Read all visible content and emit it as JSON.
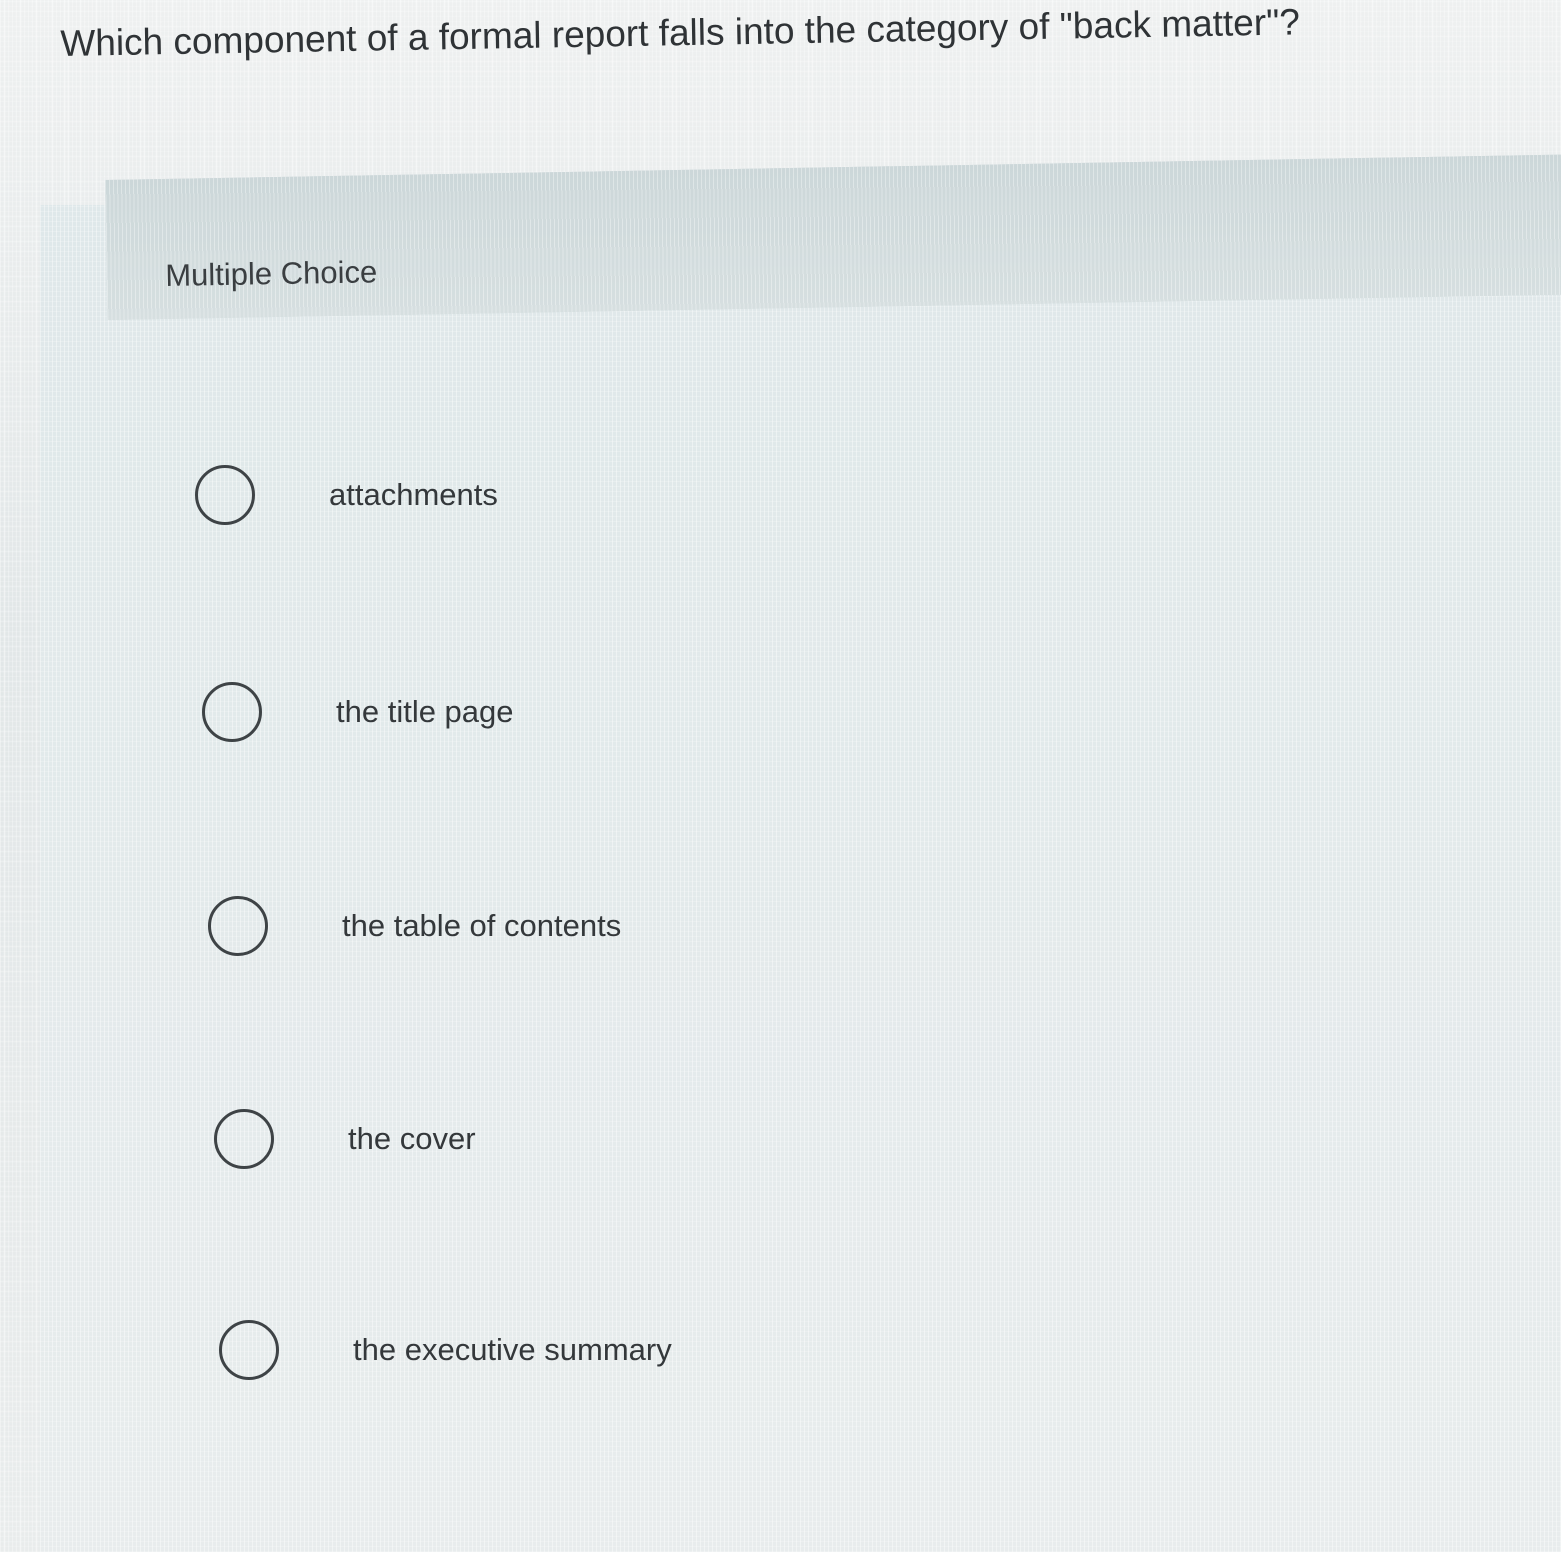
{
  "question": {
    "text": "Which component of a formal report falls into the category of \"back matter\"?"
  },
  "panel": {
    "title": "Multiple Choice"
  },
  "options": [
    {
      "label": "attachments",
      "selected": false
    },
    {
      "label": "the title page",
      "selected": false
    },
    {
      "label": "the table of contents",
      "selected": false
    },
    {
      "label": "the cover",
      "selected": false
    },
    {
      "label": "the executive summary",
      "selected": false
    }
  ],
  "colors": {
    "text": "#2f3336",
    "radio_border": "#3e4346",
    "panel_background": "#dfe7e9",
    "header_band": "#d2dcde"
  },
  "icons": {
    "option_marker": "radio-unchecked-icon"
  }
}
